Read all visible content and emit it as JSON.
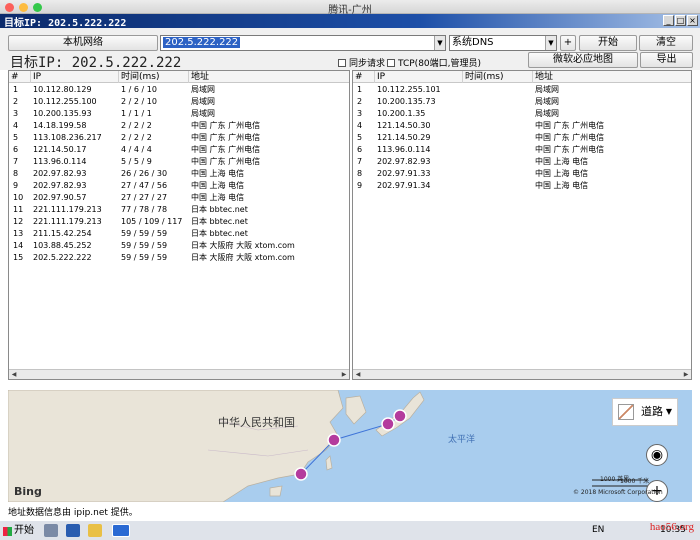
{
  "mac_title": "腾讯-广州",
  "window_title": "目标IP: 202.5.222.222",
  "toolbar": {
    "local_network_label": "本机网络",
    "host_input_value": "202.5.222.222",
    "dns_select_value": "系统DNS",
    "plus_label": "+",
    "start_label": "开始",
    "clear_label": "清空",
    "target_ip_label": "目标IP: 202.5.222.222",
    "sync_request_label": "同步请求",
    "tcp_label": "TCP(80端口,管理员)",
    "ms_map_label": "微软必应地图",
    "export_label": "导出"
  },
  "table_headers": {
    "num": "#",
    "ip": "IP",
    "time": "时间(ms)",
    "addr": "地址"
  },
  "left_rows": [
    {
      "num": "1",
      "ip": "10.112.80.129",
      "time": "1 / 6 / 10",
      "addr": "局域网"
    },
    {
      "num": "2",
      "ip": "10.112.255.100",
      "time": "2 / 2 / 10",
      "addr": "局域网"
    },
    {
      "num": "3",
      "ip": "10.200.135.93",
      "time": "1 / 1 / 1",
      "addr": "局域网"
    },
    {
      "num": "4",
      "ip": "14.18.199.58",
      "time": "2 / 2 / 2",
      "addr": "中国 广东 广州电信"
    },
    {
      "num": "5",
      "ip": "113.108.236.217",
      "time": "2 / 2 / 2",
      "addr": "中国 广东 广州电信"
    },
    {
      "num": "6",
      "ip": "121.14.50.17",
      "time": "4 / 4 / 4",
      "addr": "中国 广东 广州电信"
    },
    {
      "num": "7",
      "ip": "113.96.0.114",
      "time": "5 / 5 / 9",
      "addr": "中国 广东 广州电信"
    },
    {
      "num": "8",
      "ip": "202.97.82.93",
      "time": "26 / 26 / 30",
      "addr": "中国 上海 电信"
    },
    {
      "num": "9",
      "ip": "202.97.82.93",
      "time": "27 / 47 / 56",
      "addr": "中国 上海 电信"
    },
    {
      "num": "10",
      "ip": "202.97.90.57",
      "time": "27 / 27 / 27",
      "addr": "中国 上海 电信"
    },
    {
      "num": "11",
      "ip": "221.111.179.213",
      "time": "77 / 78 / 78",
      "addr": "日本 bbtec.net"
    },
    {
      "num": "12",
      "ip": "221.111.179.213",
      "time": "105 / 109 / 117",
      "addr": "日本 bbtec.net"
    },
    {
      "num": "13",
      "ip": "211.15.42.254",
      "time": "59 / 59 / 59",
      "addr": "日本 bbtec.net"
    },
    {
      "num": "14",
      "ip": "103.88.45.252",
      "time": "59 / 59 / 59",
      "addr": "日本 大阪府 大阪 xtom.com"
    },
    {
      "num": "15",
      "ip": "202.5.222.222",
      "time": "59 / 59 / 59",
      "addr": "日本 大阪府 大阪 xtom.com"
    }
  ],
  "right_rows": [
    {
      "num": "1",
      "ip": "10.112.255.101",
      "time": "",
      "addr": "局域网"
    },
    {
      "num": "2",
      "ip": "10.200.135.73",
      "time": "",
      "addr": "局域网"
    },
    {
      "num": "3",
      "ip": "10.200.1.35",
      "time": "",
      "addr": "局域网"
    },
    {
      "num": "4",
      "ip": "121.14.50.30",
      "time": "",
      "addr": "中国 广东 广州电信"
    },
    {
      "num": "5",
      "ip": "121.14.50.29",
      "time": "",
      "addr": "中国 广东 广州电信"
    },
    {
      "num": "6",
      "ip": "113.96.0.114",
      "time": "",
      "addr": "中国 广东 广州电信"
    },
    {
      "num": "7",
      "ip": "202.97.82.93",
      "time": "",
      "addr": "中国 上海 电信"
    },
    {
      "num": "8",
      "ip": "202.97.91.33",
      "time": "",
      "addr": "中国 上海 电信"
    },
    {
      "num": "9",
      "ip": "202.97.91.34",
      "time": "",
      "addr": "中国 上海 电信"
    }
  ],
  "map": {
    "country_label": "中华人民共和国",
    "ocean_label": "太平洋",
    "road_label": "道路",
    "scale_km": "1000 英里",
    "scale_mi": "1000 千米",
    "copyright": "© 2018 Microsoft Corporation",
    "bing_label": "Bing"
  },
  "status_text": "地址数据信息由 ipip.net 提供。",
  "taskbar": {
    "start_label": "开始",
    "lang": "EN",
    "clock": "10:35"
  },
  "watermark": "hao56.org",
  "colors": {
    "title_blue": "#0b2a6b",
    "map_water": "#a9cdee",
    "map_land": "#e9e4d8",
    "route_point": "#b43b9d"
  }
}
